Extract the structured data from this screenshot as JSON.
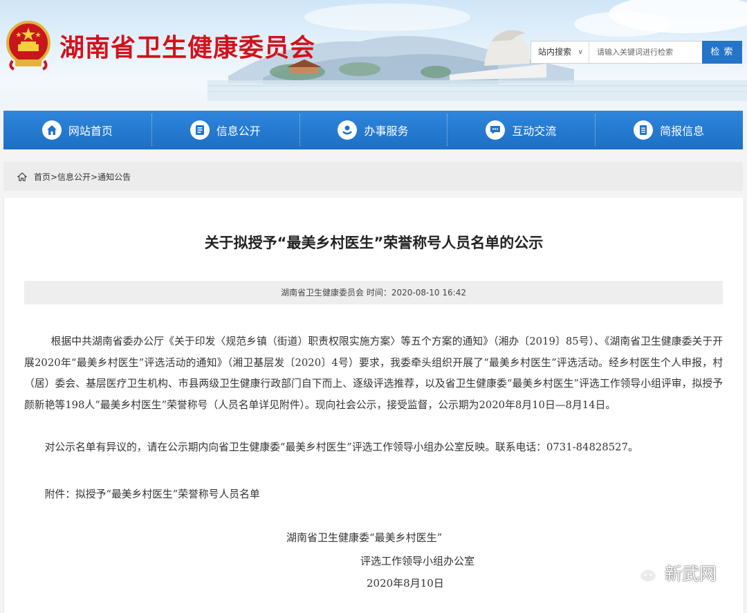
{
  "header": {
    "site_title": "湖南省卫生健康委员会",
    "search": {
      "scope_label": "站内搜索",
      "placeholder": "请输入关键词进行检索",
      "button_label": "检 索"
    }
  },
  "nav": {
    "items": [
      {
        "label": "网站首页",
        "icon": "home-icon"
      },
      {
        "label": "信息公开",
        "icon": "document-icon"
      },
      {
        "label": "办事服务",
        "icon": "service-icon"
      },
      {
        "label": "互动交流",
        "icon": "chat-icon"
      },
      {
        "label": "简报信息",
        "icon": "briefing-icon"
      }
    ]
  },
  "breadcrumb": {
    "path": [
      "首页",
      "信息公开",
      "通知公告"
    ],
    "text": "首页>信息公开>通知公告"
  },
  "article": {
    "title": "关于拟授予“最美乡村医生”荣誉称号人员名单的公示",
    "meta": "湖南省卫生健康委员会 时间：2020-08-10 16:42",
    "paragraphs": [
      "根据中共湖南省委办公厅《关于印发〈规范乡镇（街道）职责权限实施方案〉等五个方案的通知》（湘办〔2019〕85号）、《湖南省卫生健康委关于开展2020年“最美乡村医生”评选活动的通知》（湘卫基层发〔2020〕4号）要求，我委牵头组织开展了“最美乡村医生”评选活动。经乡村医生个人申报，村（居）委会、基层医疗卫生机构、市县两级卫生健康行政部门自下而上、逐级评选推荐，以及省卫生健康委“最美乡村医生”评选工作领导小组评审，拟授予颜新艳等198人“最美乡村医生”荣誉称号（人员名单详见附件）。现向社会公示，接受监督，公示期为2020年8月10日—8月14日。",
      "对公示名单有异议的，请在公示期内向省卫生健康委“最美乡村医生”评选工作领导小组办公室反映。联系电话：0731-84828527。",
      "附件：拟授予“最美乡村医生”荣誉称号人员名单"
    ],
    "signature": {
      "line1": "湖南省卫生健康委“最美乡村医生”",
      "line2": "评选工作领导小组办公室",
      "date": "2020年8月10日"
    }
  },
  "watermark": {
    "text": "新武网",
    "icon": "wechat-icon"
  },
  "colors": {
    "title_red": "#d1121b",
    "nav_blue": "#1f73c8",
    "search_button": "#2474c8"
  }
}
